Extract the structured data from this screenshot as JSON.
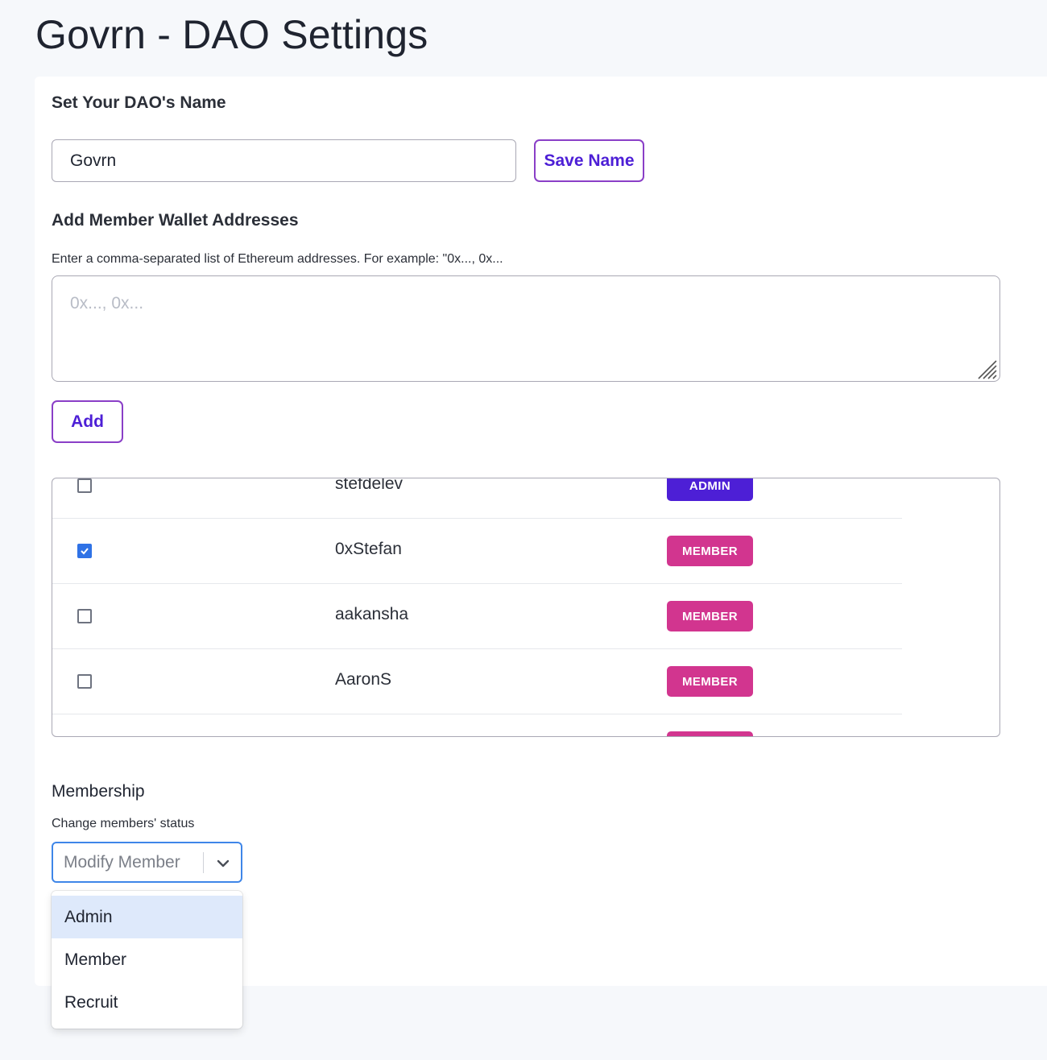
{
  "page": {
    "title": "Govrn - DAO Settings"
  },
  "dao_name": {
    "heading": "Set Your DAO's Name",
    "input_value": "Govrn",
    "save_label": "Save Name"
  },
  "add_members": {
    "heading": "Add Member Wallet Addresses",
    "helper": "Enter a comma-separated list of Ethereum addresses. For example: \"0x..., 0x...",
    "placeholder": "0x..., 0x...",
    "add_label": "Add"
  },
  "members": {
    "rows": [
      {
        "name": "stefdelev",
        "role": "ADMIN",
        "checked": false,
        "color": "#4d1fd6"
      },
      {
        "name": "0xStefan",
        "role": "MEMBER",
        "checked": true,
        "color": "#d2358f"
      },
      {
        "name": "aakansha",
        "role": "MEMBER",
        "checked": false,
        "color": "#d2358f"
      },
      {
        "name": "AaronS",
        "role": "MEMBER",
        "checked": false,
        "color": "#d2358f"
      },
      {
        "name": "",
        "role": "",
        "checked": false,
        "color": "#d2358f"
      }
    ]
  },
  "membership": {
    "heading": "Membership",
    "helper": "Change members' status",
    "select_placeholder": "Modify Member",
    "options": [
      "Admin",
      "Member",
      "Recruit"
    ],
    "highlighted": "Admin"
  },
  "colors": {
    "accent_purple": "#4d1fd6",
    "accent_pink": "#d2358f",
    "focus_blue": "#3f86e8",
    "checkbox_blue": "#2f72e6"
  }
}
